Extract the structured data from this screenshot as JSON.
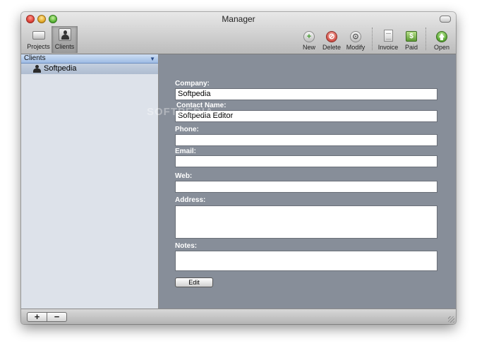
{
  "window": {
    "title": "Manager"
  },
  "toolbar": {
    "left": [
      {
        "id": "projects",
        "label": "Projects",
        "icon": "drive-icon"
      },
      {
        "id": "clients",
        "label": "Clients",
        "icon": "person-icon",
        "selected": true
      }
    ],
    "right": [
      {
        "id": "new",
        "label": "New",
        "icon": "plus-circle-icon"
      },
      {
        "id": "delete",
        "label": "Delete",
        "icon": "delete-circle-icon"
      },
      {
        "id": "modify",
        "label": "Modify",
        "icon": "modify-circle-icon"
      },
      {
        "id": "invoice",
        "label": "Invoice",
        "icon": "document-icon"
      },
      {
        "id": "paid",
        "label": "Paid",
        "icon": "dollar-icon"
      },
      {
        "id": "open",
        "label": "Open",
        "icon": "up-arrow-icon"
      }
    ]
  },
  "sidebar": {
    "header": "Clients",
    "items": [
      {
        "label": "Softpedia",
        "icon": "person-icon",
        "selected": true
      }
    ]
  },
  "form": {
    "company_label": "Company:",
    "company_value": "Softpedia",
    "contact_label": "Contact Name:",
    "contact_value": "Softpedia Editor",
    "phone_label": "Phone:",
    "phone_value": "",
    "email_label": "Email:",
    "email_value": "",
    "web_label": "Web:",
    "web_value": "",
    "address_label": "Address:",
    "address_value": "",
    "notes_label": "Notes:",
    "notes_value": "",
    "edit_label": "Edit"
  },
  "watermark": "SOFTPEDIA",
  "bottombar": {
    "add_label": "+",
    "remove_label": "−"
  }
}
